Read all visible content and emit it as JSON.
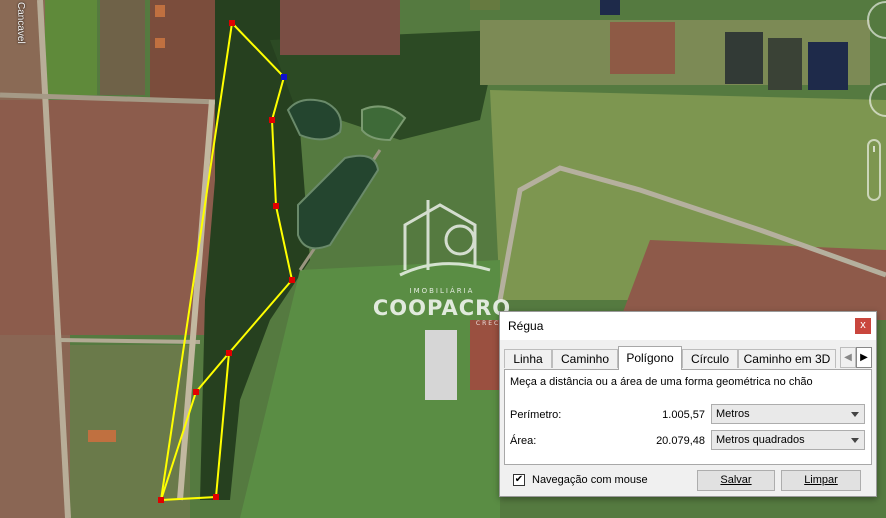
{
  "map": {
    "road_label": "Cancavel",
    "watermark": {
      "small": "IMOBILIÁRIA",
      "big": "COOPACRO",
      "tiny": "CRECI"
    }
  },
  "dialog": {
    "title": "Régua",
    "close_glyph": "x",
    "tabs": [
      {
        "label": "Linha"
      },
      {
        "label": "Caminho"
      },
      {
        "label": "Polígono",
        "active": true
      },
      {
        "label": "Círculo"
      },
      {
        "label": "Caminho em 3D"
      }
    ],
    "tab_scroll_left": "◀",
    "tab_scroll_right": "▶",
    "description": "Meça a distância ou a área de uma forma geométrica no chão",
    "perimeter": {
      "label": "Perímetro:",
      "value": "1.005,57",
      "unit": "Metros"
    },
    "area": {
      "label": "Área:",
      "value": "20.079,48",
      "unit": "Metros quadrados"
    },
    "mouse_nav": {
      "label": "Navegação com mouse",
      "checked": true,
      "glyph": "✔"
    },
    "save_label": "Salvar",
    "clear_label": "Limpar"
  },
  "colors": {
    "polygon_line": "#ffff00",
    "vertex": "#e00000",
    "active_vertex": "#1010d0",
    "close_button": "#c9463d"
  }
}
